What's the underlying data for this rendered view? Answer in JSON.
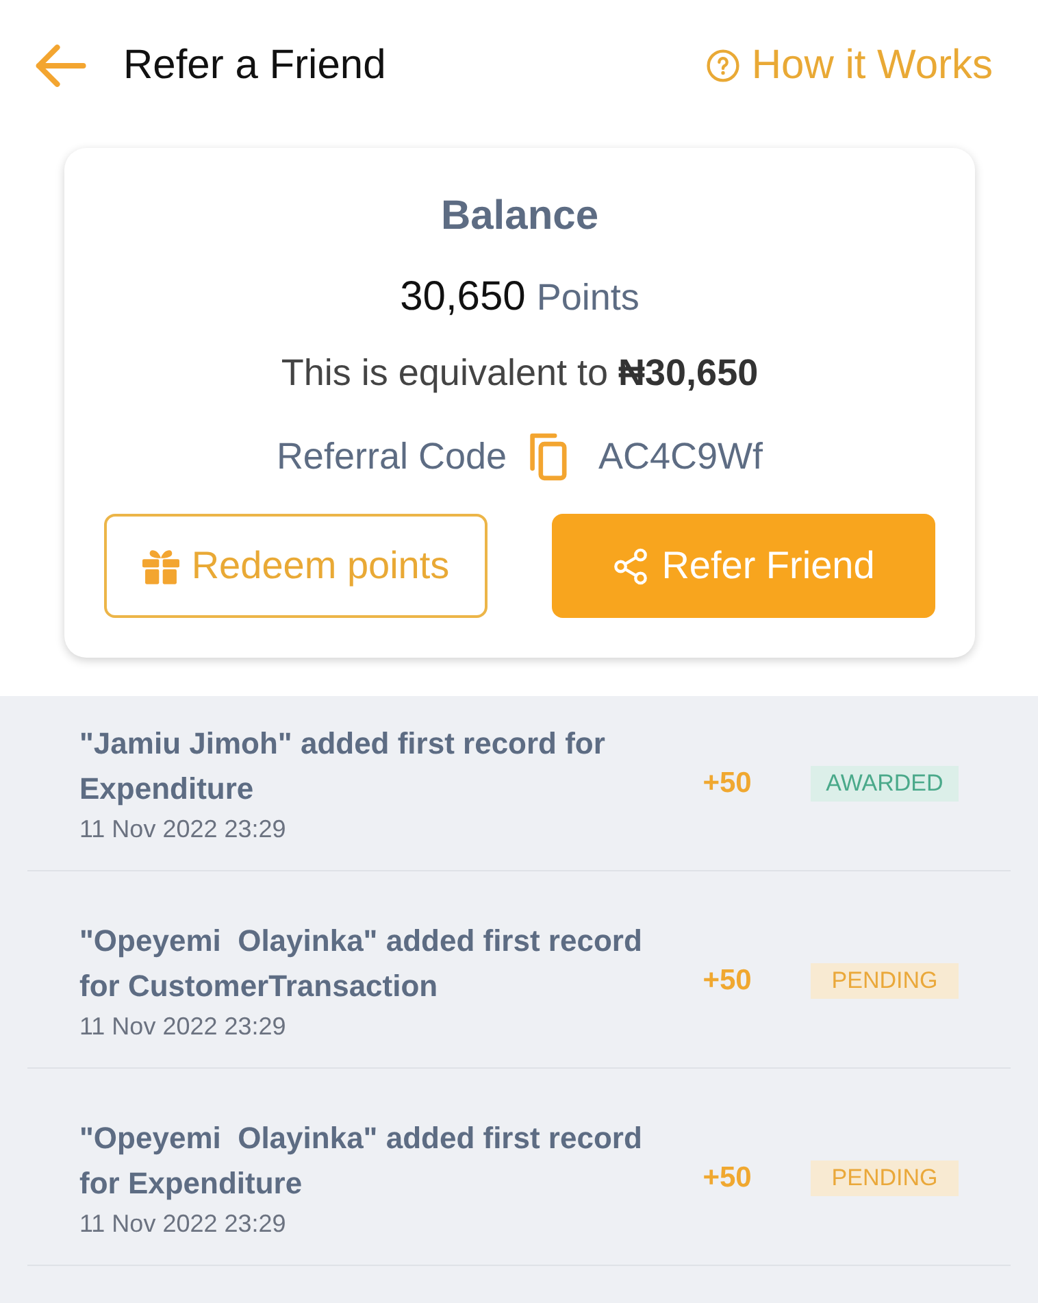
{
  "header": {
    "title": "Refer a Friend",
    "help_link": "How it Works"
  },
  "balance_card": {
    "title": "Balance",
    "points": "30,650",
    "points_unit": "Points",
    "equivalent": "This is equivalent to **₦30,650**",
    "referral_label": "Referral Code",
    "referral_code": "AC4C9Wf",
    "buttons": [
      {
        "label": "Redeem points",
        "kind": "redeem"
      },
      {
        "label": "Refer Friend",
        "kind": "share"
      }
    ]
  },
  "activities": [
    {
      "description": "\"Jamiu Jimoh\" added first record for Expenditure",
      "date": "11 Nov 2022 23:29",
      "points": "+50",
      "status": "AWARDED",
      "kind": "awarded"
    },
    {
      "description": "\"Opeyemi  Olayinka\" added first record for CustomerTransaction",
      "date": "11 Nov 2022 23:29",
      "points": "+50",
      "status": "PENDING",
      "kind": "pending"
    },
    {
      "description": "\"Opeyemi  Olayinka\" added first record for Expenditure",
      "date": "11 Nov 2022 23:29",
      "points": "+50",
      "status": "PENDING",
      "kind": "pending"
    }
  ]
}
